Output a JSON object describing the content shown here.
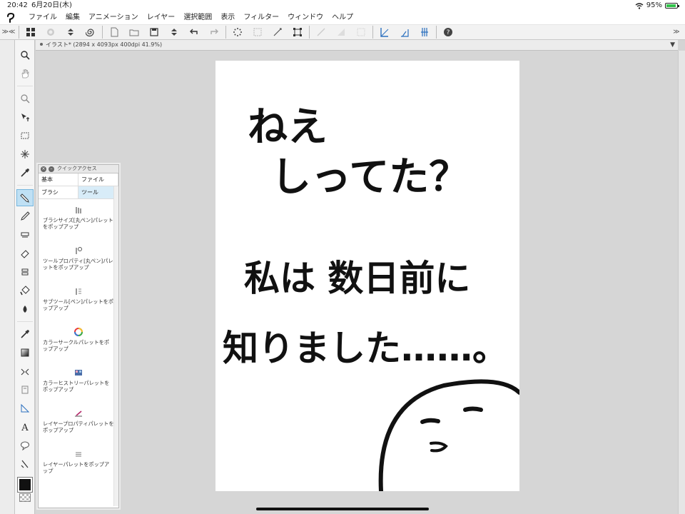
{
  "status_bar": {
    "time": "20:42",
    "date": "6月20日(木)",
    "battery": "95%"
  },
  "menu": {
    "items": [
      "ファイル",
      "編集",
      "アニメーション",
      "レイヤー",
      "選択範囲",
      "表示",
      "フィルター",
      "ウィンドウ",
      "ヘルプ"
    ]
  },
  "command_bar": {
    "left_toggle": "≫",
    "left_toggle2": "≪",
    "right_toggle": "≫",
    "buttons": [
      "grid-icon",
      "record-icon",
      "stepper-icon",
      "spiral-icon",
      "new-doc-icon",
      "open-icon",
      "save-icon",
      "stepper-icon",
      "undo-icon",
      "redo-icon",
      "loading-icon",
      "clear-selection-icon",
      "invert-selection-icon",
      "transform-icon",
      "fill-icon",
      "tone-icon",
      "border-icon",
      "ruler-icon",
      "symmetric-ruler-icon",
      "perspective-ruler-icon",
      "help-icon"
    ]
  },
  "document": {
    "tab_title": "イラスト* (2894 x 4093px 400dpi 41.9%)"
  },
  "tools": [
    "zoom-icon",
    "hand-icon",
    "zoom-out-icon",
    "move-icon",
    "selection-icon",
    "auto-select-icon",
    "eyedropper-icon",
    "pen-icon",
    "pencil-icon",
    "brush-icon",
    "airbrush-icon",
    "eraser-icon",
    "blend-icon",
    "decoration-icon",
    "fill-icon",
    "eyedropper2-icon",
    "gradient-icon",
    "figure-icon",
    "frame-icon",
    "ruler-icon",
    "text-icon",
    "balloon-icon",
    "correction-icon"
  ],
  "quick_access": {
    "title": "クイックアクセス",
    "tabs": [
      "基本",
      "ファイル",
      "ブラシ",
      "ツール"
    ],
    "active_tab": "ツール",
    "items": [
      {
        "icon": "brush-size-icon",
        "label": "ブラシサイズ[丸ペン]パレットをポップアップ"
      },
      {
        "icon": "tool-property-icon",
        "label": "ツールプロパティ[丸ペン]パレットをポップアップ"
      },
      {
        "icon": "subtool-icon",
        "label": "サブツール[ペン]パレットをポップアップ"
      },
      {
        "icon": "color-circle-icon",
        "label": "カラーサークルパレットをポップアップ"
      },
      {
        "icon": "color-history-icon",
        "label": "カラーヒストリーパレットをポップアップ"
      },
      {
        "icon": "layer-property-icon",
        "label": "レイヤープロパティパレットをポップアップ"
      },
      {
        "icon": "layer-palette-icon",
        "label": "レイヤーパレットをポップアップ"
      }
    ]
  },
  "canvas_text": {
    "line1": "ねえ",
    "line2": "しってた？",
    "line3": "私は 数日前に",
    "line4": "知りました……。"
  },
  "colors": {
    "main_color": "#111111",
    "accent": "#76b6dd",
    "canvas_bg": "#ffffff"
  }
}
